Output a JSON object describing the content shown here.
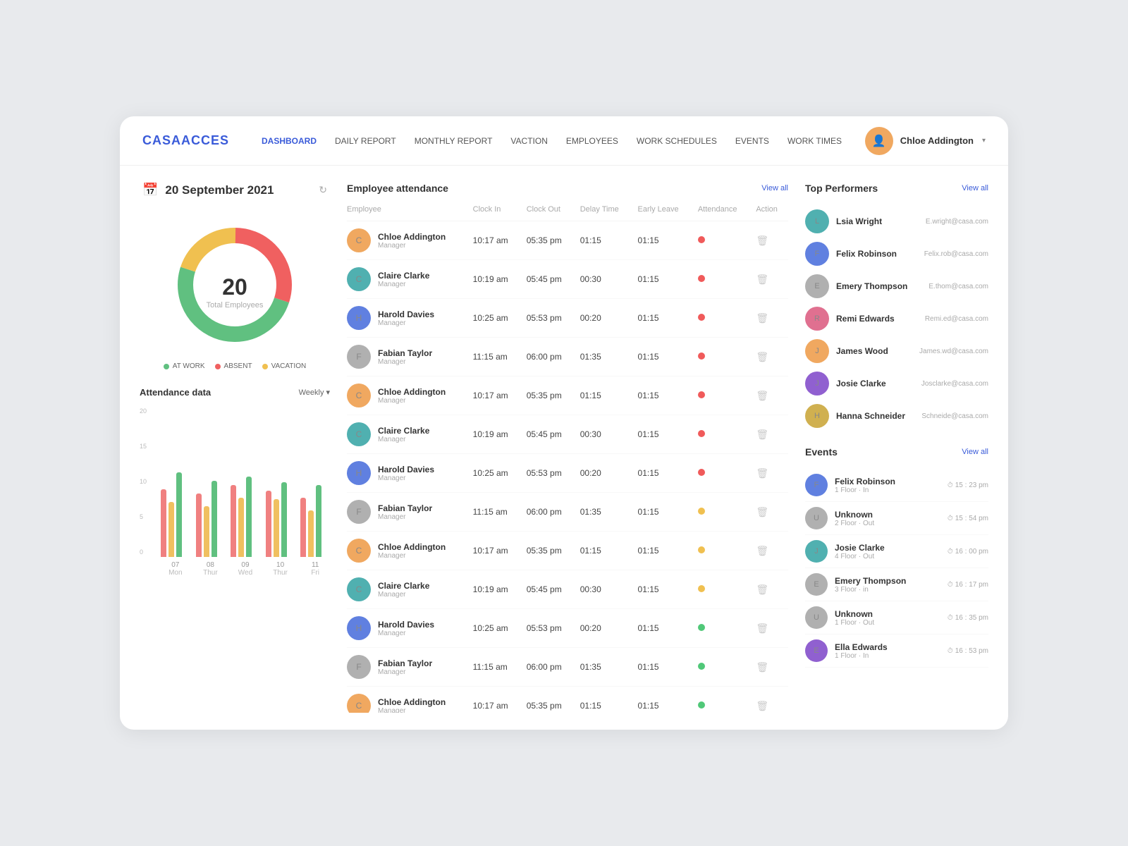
{
  "app": {
    "logo": "CASAACCES",
    "nav": [
      {
        "label": "DASHBOARD",
        "active": true
      },
      {
        "label": "DAILY REPORT",
        "active": false
      },
      {
        "label": "MONTHLY REPORT",
        "active": false
      },
      {
        "label": "VACTION",
        "active": false
      },
      {
        "label": "EMPLOYEES",
        "active": false
      },
      {
        "label": "WORK SCHEDULES",
        "active": false
      },
      {
        "label": "EVENTS",
        "active": false
      },
      {
        "label": "WORK TIMES",
        "active": false
      }
    ],
    "user": {
      "name": "Chloe Addington",
      "avatar_color": "av-orange"
    }
  },
  "date_widget": {
    "date": "20 September 2021"
  },
  "donut": {
    "total": "20",
    "label": "Total Employees",
    "segments": [
      {
        "color": "#f06060",
        "value": 30,
        "offset": 0
      },
      {
        "color": "#60c080",
        "value": 50,
        "offset": 30
      },
      {
        "color": "#f0c050",
        "value": 20,
        "offset": 80
      }
    ],
    "legend": [
      {
        "label": "AT WORK",
        "color": "#60c080"
      },
      {
        "label": "ABSENT",
        "color": "#f06060"
      },
      {
        "label": "VACATION",
        "color": "#f0c050"
      }
    ]
  },
  "bar_chart": {
    "title": "Attendance data",
    "filter": "Weekly",
    "y_labels": [
      "20",
      "15",
      "10",
      "5",
      "0"
    ],
    "bars": [
      {
        "day": "Mon",
        "num": "07",
        "red": 80,
        "yellow": 65,
        "green": 100
      },
      {
        "day": "Thur",
        "num": "08",
        "red": 75,
        "yellow": 60,
        "green": 90
      },
      {
        "day": "Wed",
        "num": "09",
        "red": 85,
        "yellow": 70,
        "green": 95
      },
      {
        "day": "Thur",
        "num": "10",
        "red": 78,
        "yellow": 68,
        "green": 88
      },
      {
        "day": "Fri",
        "num": "11",
        "red": 70,
        "yellow": 55,
        "green": 85
      }
    ]
  },
  "attendance": {
    "title": "Employee attendance",
    "view_all": "View all",
    "columns": [
      "Employee",
      "Clock In",
      "Clock Out",
      "Delay Time",
      "Early Leave",
      "Attendance",
      "Action"
    ],
    "rows": [
      {
        "name": "Chloe Addington",
        "role": "Manager",
        "clock_in": "10:17 am",
        "clock_out": "05:35 pm",
        "delay": "01:15",
        "early": "01:15",
        "status": "red",
        "av": "av-orange"
      },
      {
        "name": "Claire Clarke",
        "role": "Manager",
        "clock_in": "10:19 am",
        "clock_out": "05:45 pm",
        "delay": "00:30",
        "early": "01:15",
        "status": "red",
        "av": "av-teal"
      },
      {
        "name": "Harold Davies",
        "role": "Manager",
        "clock_in": "10:25 am",
        "clock_out": "05:53 pm",
        "delay": "00:20",
        "early": "01:15",
        "status": "red",
        "av": "av-blue"
      },
      {
        "name": "Fabian Taylor",
        "role": "Manager",
        "clock_in": "11:15 am",
        "clock_out": "06:00 pm",
        "delay": "01:35",
        "early": "01:15",
        "status": "red",
        "av": "av-gray"
      },
      {
        "name": "Chloe Addington",
        "role": "Manager",
        "clock_in": "10:17 am",
        "clock_out": "05:35 pm",
        "delay": "01:15",
        "early": "01:15",
        "status": "red",
        "av": "av-orange"
      },
      {
        "name": "Claire Clarke",
        "role": "Manager",
        "clock_in": "10:19 am",
        "clock_out": "05:45 pm",
        "delay": "00:30",
        "early": "01:15",
        "status": "red",
        "av": "av-teal"
      },
      {
        "name": "Harold Davies",
        "role": "Manager",
        "clock_in": "10:25 am",
        "clock_out": "05:53 pm",
        "delay": "00:20",
        "early": "01:15",
        "status": "red",
        "av": "av-blue"
      },
      {
        "name": "Fabian Taylor",
        "role": "Manager",
        "clock_in": "11:15 am",
        "clock_out": "06:00 pm",
        "delay": "01:35",
        "early": "01:15",
        "status": "yellow",
        "av": "av-gray"
      },
      {
        "name": "Chloe Addington",
        "role": "Manager",
        "clock_in": "10:17 am",
        "clock_out": "05:35 pm",
        "delay": "01:15",
        "early": "01:15",
        "status": "yellow",
        "av": "av-orange"
      },
      {
        "name": "Claire Clarke",
        "role": "Manager",
        "clock_in": "10:19 am",
        "clock_out": "05:45 pm",
        "delay": "00:30",
        "early": "01:15",
        "status": "yellow",
        "av": "av-teal"
      },
      {
        "name": "Harold Davies",
        "role": "Manager",
        "clock_in": "10:25 am",
        "clock_out": "05:53 pm",
        "delay": "00:20",
        "early": "01:15",
        "status": "green",
        "av": "av-blue"
      },
      {
        "name": "Fabian Taylor",
        "role": "Manager",
        "clock_in": "11:15 am",
        "clock_out": "06:00 pm",
        "delay": "01:35",
        "early": "01:15",
        "status": "green",
        "av": "av-gray"
      },
      {
        "name": "Chloe Addington",
        "role": "Manager",
        "clock_in": "10:17 am",
        "clock_out": "05:35 pm",
        "delay": "01:15",
        "early": "01:15",
        "status": "green",
        "av": "av-orange"
      }
    ]
  },
  "top_performers": {
    "title": "Top Performers",
    "view_all": "View all",
    "items": [
      {
        "name": "Lsia Wright",
        "email": "E.wright@casa.com",
        "av": "av-teal"
      },
      {
        "name": "Felix Robinson",
        "email": "Felix.rob@casa.com",
        "av": "av-blue"
      },
      {
        "name": "Emery Thompson",
        "email": "E.thom@casa.com",
        "av": "av-gray"
      },
      {
        "name": "Remi Edwards",
        "email": "Remi.ed@casa.com",
        "av": "av-pink"
      },
      {
        "name": "James Wood",
        "email": "James.wd@casa.com",
        "av": "av-orange"
      },
      {
        "name": "Josie Clarke",
        "email": "Josclarke@casa.com",
        "av": "av-purple"
      },
      {
        "name": "Hanna Schneider",
        "email": "Schneide@casa.com",
        "av": "av-yellow"
      }
    ]
  },
  "events": {
    "title": "Events",
    "view_all": "View all",
    "items": [
      {
        "name": "Felix Robinson",
        "sub": "1 Floor · In",
        "time": "15 : 23 pm",
        "av": "av-blue"
      },
      {
        "name": "Unknown",
        "sub": "2 Floor · Out",
        "time": "15 : 54 pm",
        "av": "av-gray"
      },
      {
        "name": "Josie Clarke",
        "sub": "4 Floor · Out",
        "time": "16 : 00 pm",
        "av": "av-teal"
      },
      {
        "name": "Emery Thompson",
        "sub": "3 Floor · in",
        "time": "16 : 17 pm",
        "av": "av-gray"
      },
      {
        "name": "Unknown",
        "sub": "1 Floor · Out",
        "time": "16 : 35 pm",
        "av": "av-gray"
      },
      {
        "name": "Ella Edwards",
        "sub": "1 Floor · In",
        "time": "16 : 53 pm",
        "av": "av-purple"
      }
    ]
  }
}
